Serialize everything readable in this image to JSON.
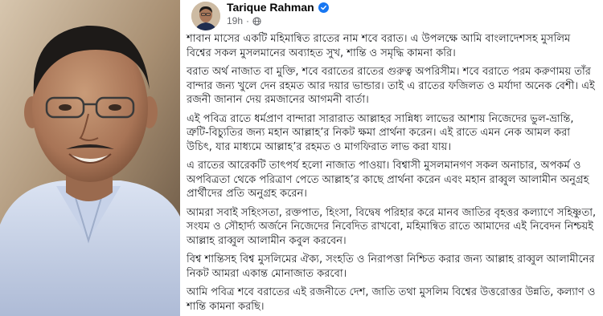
{
  "post": {
    "author": "Tarique Rahman",
    "time": "19h",
    "separator": "·",
    "paragraphs": [
      "শাবান মাসের একটি মহিমান্বিত রাতের নাম শবে বরাত। এ উপলক্ষে আমি বাংলাদেশসহ মুসলিম বিশ্বের সকল মুসলমানের অব্যাহত সুখ, শান্তি ও সমৃদ্ধি কামনা করি।",
      "বরাত অর্থ নাজাত বা মুক্তি, শবে বরাতের রাতের গুরুত্ব অপরিসীম। শবে বরাতে পরম করুণাময় তাঁর বান্দার জন্য খুলে দেন রহমত আর দয়ার ভান্ডার। তাই এ রাতের ফজিলত ও মর্যাদা অনেক বেশী। এই রজনী জানান দেয় রমজানের আগমনী বার্তা।",
      "এই পবিত্র রাতে ধর্মপ্রাণ বান্দারা সারারাত আল্লাহর সান্নিধ্য লাভের আশায় নিজেদের ভুল-ভ্রান্তি, ত্রুটি-বিচ্যুতির জন্য মহান আল্লাহ’র নিকট ক্ষমা প্রার্থনা করেন। এই রাতে এমন নেক আমল করা উচিৎ, যার মাধ্যমে আল্লাহ’র রহমত ও মাগফিরাত লাভ করা যায়।",
      "এ রাতের আরেকটি তাৎপর্য হলো নাজাত পাওয়া। বিশ্বাসী মুসলমানগণ সকল অনাচার, অপকর্ম ও অপবিত্রতা থেকে পরিত্রাণ পেতে আল্লাহ’র কাছে প্রার্থনা করেন এবং মহান রাব্বুল আলামীন অনুগ্রহ প্রার্থীদের প্রতি অনুগ্রহ করেন।",
      "আমরা সবাই সহিংসতা, রক্তপাত, হিংসা, বিদ্বেষ পরিহার করে মানব জাতির বৃহত্তর কল্যাণে সহিষ্ণুতা, সংযম ও সৌহার্দ্য অর্জনে নিজেদের নিবেদিত রাখবো, মহিমান্বিত রাতে আমাদের এই নিবেদন নিশ্চয়ই আল্লাহ রাব্বুল আলামীন কবুল করবেন।",
      "বিশ্ব শান্তিসহ বিশ্ব মুসলিমের ঐক্য, সংহতি ও নিরাপত্তা নিশ্চিত করার জন্য আল্লাহ রাব্বুল আলামীনের নিকট আমরা একান্ত মোনাজাত করবো।",
      "আমি পবিত্র শবে বরাতের এই রজনীতে দেশ, জাতি তথা মুসলিম বিশ্বের উত্তরোত্তর উন্নতি, কল্যাণ ও শান্তি কামনা করছি।"
    ]
  },
  "icons": {
    "verified": "verified-badge-icon",
    "audience": "globe-icon"
  },
  "colors": {
    "verified": "#1877f2",
    "text": "#1c1e21",
    "meta": "#65676b"
  }
}
